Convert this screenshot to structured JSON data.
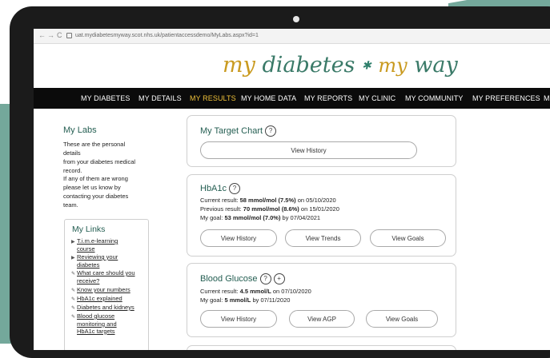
{
  "browser": {
    "back_glyph": "←",
    "forward_glyph": "→",
    "reload_glyph": "C",
    "url": "uat.mydiabetesmyway.scot.nhs.uk/patientaccessdemo/MyLabs.aspx?id=1"
  },
  "logo": {
    "w1": "my",
    "w2": "diabetes",
    "star": "✱",
    "w3": "my",
    "w4": "way"
  },
  "nav": {
    "items": [
      {
        "label": "MY DIABETES"
      },
      {
        "label": "MY DETAILS"
      },
      {
        "label": "MY RESULTS"
      },
      {
        "label": "MY HOME DATA"
      },
      {
        "label": "MY REPORTS"
      },
      {
        "label": "MY CLINIC"
      },
      {
        "label": "MY COMMUNITY"
      },
      {
        "label": "MY PREFERENCES"
      },
      {
        "label": "MY S"
      }
    ],
    "active_color": "#f0c23a"
  },
  "sidebar": {
    "title": "My Labs",
    "intro_lines": [
      "These are the personal details",
      "from your diabetes medical",
      "record."
    ],
    "help_lines": [
      "If any of them are wrong",
      "please let us know by",
      "contacting your diabetes",
      "team."
    ],
    "links_title": "My Links",
    "links": [
      {
        "lines": [
          "T.i.m.e-learning",
          "course"
        ]
      },
      {
        "lines": [
          "Reviewing your",
          "diabetes"
        ]
      },
      {
        "lines": [
          "What care should you",
          "receive?"
        ]
      },
      {
        "lines": [
          "Know your numbers"
        ]
      },
      {
        "lines": [
          "HbA1c explained"
        ]
      },
      {
        "lines": [
          "Diabetes and kidneys"
        ]
      },
      {
        "lines": [
          "Blood glucose",
          "monitoring and",
          "HbA1c targets"
        ]
      }
    ]
  },
  "target_chart": {
    "title": "My Target Chart",
    "button": "View History"
  },
  "hba1c": {
    "title": "HbA1c",
    "current_label": "Current result: ",
    "current_value": "58 mmol/mol (7.5%)",
    "current_on": " on 05/10/2020",
    "previous_label": "Previous result: ",
    "previous_value": "70 mmol/mol (8.6%)",
    "previous_on": " on 15/01/2020",
    "goal_label": "My goal: ",
    "goal_value": "53 mmol/mol (7.0%)",
    "goal_by": " by 07/04/2021",
    "buttons": [
      "View History",
      "View Trends",
      "View Goals"
    ]
  },
  "glucose": {
    "title": "Blood Glucose",
    "current_label": "Current result: ",
    "current_value": "4.5 mmol/L",
    "current_on": " on 07/10/2020",
    "goal_label": "My goal: ",
    "goal_value": "5 mmol/L",
    "goal_by": " by 07/11/2020",
    "buttons": [
      "View History",
      "View AGP",
      "View Goals"
    ]
  },
  "icons": {
    "help": "?",
    "add": "+"
  },
  "colors": {
    "teal": "#74a89b",
    "heading": "#245e52",
    "logo_gold": "#c99a1f",
    "logo_green": "#3a7a68"
  }
}
